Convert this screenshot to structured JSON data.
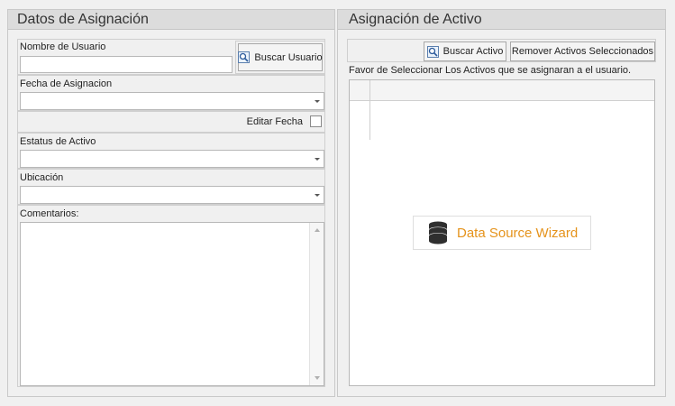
{
  "left_panel": {
    "title": "Datos de Asignación",
    "nombre_usuario_label": "Nombre de Usuario",
    "nombre_usuario_value": "",
    "buscar_usuario_label": "Buscar Usuario",
    "fecha_asignacion_label": "Fecha de Asignacion",
    "fecha_asignacion_value": "",
    "editar_fecha_label": "Editar Fecha",
    "editar_fecha_checked": false,
    "estatus_label": "Estatus de Activo",
    "estatus_value": "",
    "ubicacion_label": "Ubicación",
    "ubicacion_value": "",
    "comentarios_label": "Comentarios:",
    "comentarios_value": ""
  },
  "right_panel": {
    "title": "Asignación de Activo",
    "buscar_activo_label": "Buscar Activo",
    "remover_label": "Remover Activos Seleccionados",
    "instructions": "Favor de Seleccionar Los Activos que se asignaran a el usuario.",
    "wizard_label": "Data Source Wizard"
  },
  "colors": {
    "wizard_text": "#e5931c",
    "panel_header_bg": "#dcdcdc",
    "background": "#f0f0f0"
  },
  "icons": {
    "search": "search-icon",
    "database": "database-icon",
    "dropdown": "chevron-down-icon"
  }
}
